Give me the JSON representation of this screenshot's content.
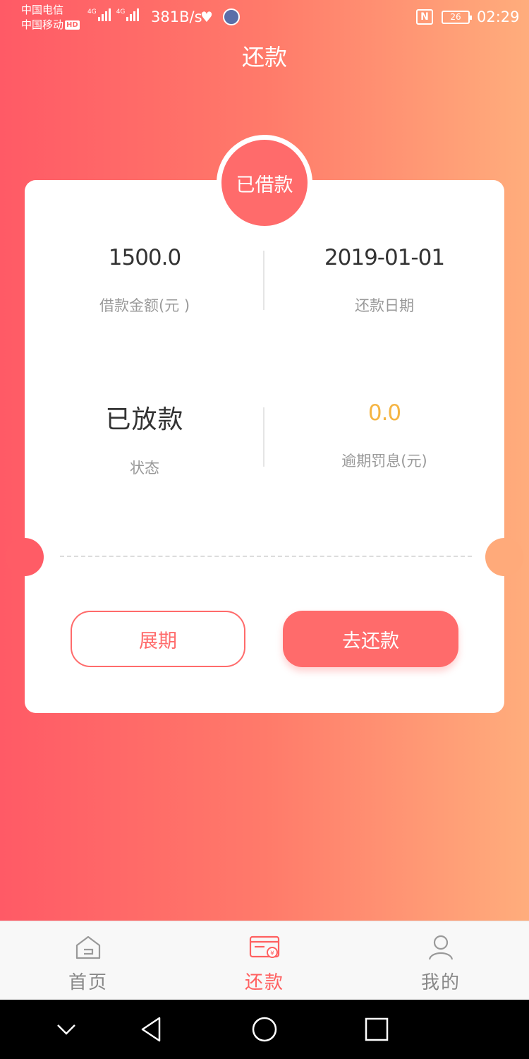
{
  "status_bar": {
    "carrier1": "中国电信",
    "carrier2": "中国移动",
    "hd": "HD",
    "net_type": "4G",
    "net_speed": "381B/s",
    "battery": "26",
    "time": "02:29"
  },
  "header": {
    "title": "还款"
  },
  "card": {
    "badge": "已借款",
    "loan_amount": {
      "value": "1500.0",
      "label": "借款金额(元 )"
    },
    "repay_date": {
      "value": "2019-01-01",
      "label": "还款日期"
    },
    "status": {
      "value": "已放款",
      "label": "状态"
    },
    "overdue_fee": {
      "value": "0.0",
      "label": "逾期罚息(元)"
    },
    "extend_button": "展期",
    "repay_button": "去还款"
  },
  "tabs": [
    {
      "label": "首页",
      "icon": "home-icon",
      "active": false
    },
    {
      "label": "还款",
      "icon": "repay-card-icon",
      "active": true
    },
    {
      "label": "我的",
      "icon": "user-icon",
      "active": false
    }
  ],
  "colors": {
    "accent": "#ff6b6b",
    "gradient_start": "#ff5a66",
    "gradient_end": "#ffad7c",
    "overdue_value": "#f5b544"
  }
}
